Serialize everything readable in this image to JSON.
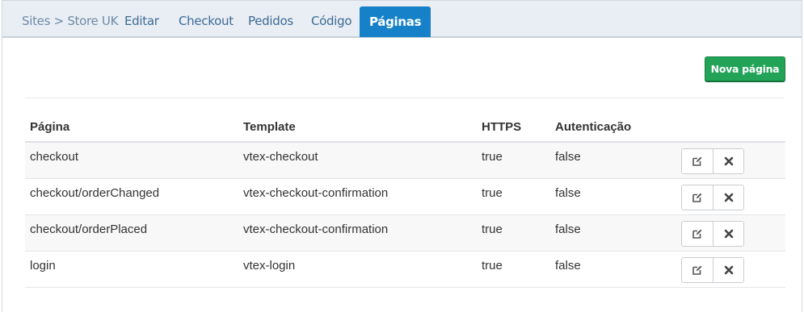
{
  "nav": {
    "breadcrumb": "Sites > Store UK",
    "tabs": [
      "Editar",
      "Checkout",
      "Pedidos",
      "Código",
      "Páginas"
    ],
    "active_tab": "Páginas"
  },
  "toolbar": {
    "new_page_label": "Nova página"
  },
  "table": {
    "headers": [
      "Página",
      "Template",
      "HTTPS",
      "Autenticação"
    ],
    "rows": [
      [
        "checkout",
        "vtex-checkout",
        "true",
        "false"
      ],
      [
        "checkout/orderChanged",
        "vtex-checkout-confirmation",
        "true",
        "false"
      ],
      [
        "checkout/orderPlaced",
        "vtex-checkout-confirmation",
        "true",
        "false"
      ],
      [
        "login",
        "vtex-login",
        "true",
        "false"
      ]
    ],
    "row_actions": [
      "edit-icon",
      "close-icon"
    ]
  },
  "colors": {
    "active_tab": "#1681c9",
    "tab_text": "#3d6a93",
    "primary_button": "#22a358",
    "tabbar_bg": "#e9eef5"
  }
}
